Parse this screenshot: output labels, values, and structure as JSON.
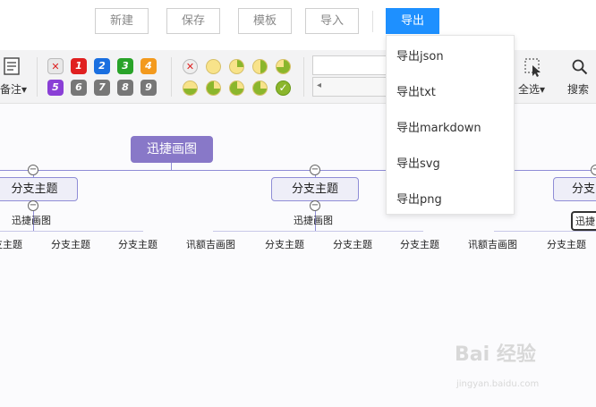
{
  "top_buttons": {
    "new": "新建",
    "save": "保存",
    "template": "模板",
    "import": "导入",
    "export": "导出"
  },
  "toolbar": {
    "note_label": "备注",
    "note_caret": "▾",
    "priority": [
      "1",
      "2",
      "3",
      "4",
      "5",
      "6",
      "7",
      "8",
      "9"
    ],
    "priority_clear_glyph": "✕",
    "progress_clear_glyph": "✕",
    "progress_done_glyph": "✓",
    "scroll_left_glyph": "◂",
    "select_all_label": "全选",
    "select_all_caret": "▾",
    "search_label": "搜索"
  },
  "export_menu": {
    "items": [
      "导出json",
      "导出txt",
      "导出markdown",
      "导出svg",
      "导出png"
    ]
  },
  "mindmap": {
    "root": "迅捷画图",
    "branches": [
      "分支主题",
      "分支主题",
      "分支"
    ],
    "sub_topics": [
      "迅捷画图",
      "迅捷画图",
      "迅捷"
    ],
    "leaves": [
      "支主题",
      "分支主题",
      "分支主题",
      "讯额吉画图",
      "分支主题",
      "分支主题",
      "分支主题",
      "讯额吉画图",
      "分支主题"
    ],
    "collapse_glyph": "−"
  },
  "watermark": {
    "main": "Bai 经验",
    "url": "jingyan.baidu.com"
  }
}
